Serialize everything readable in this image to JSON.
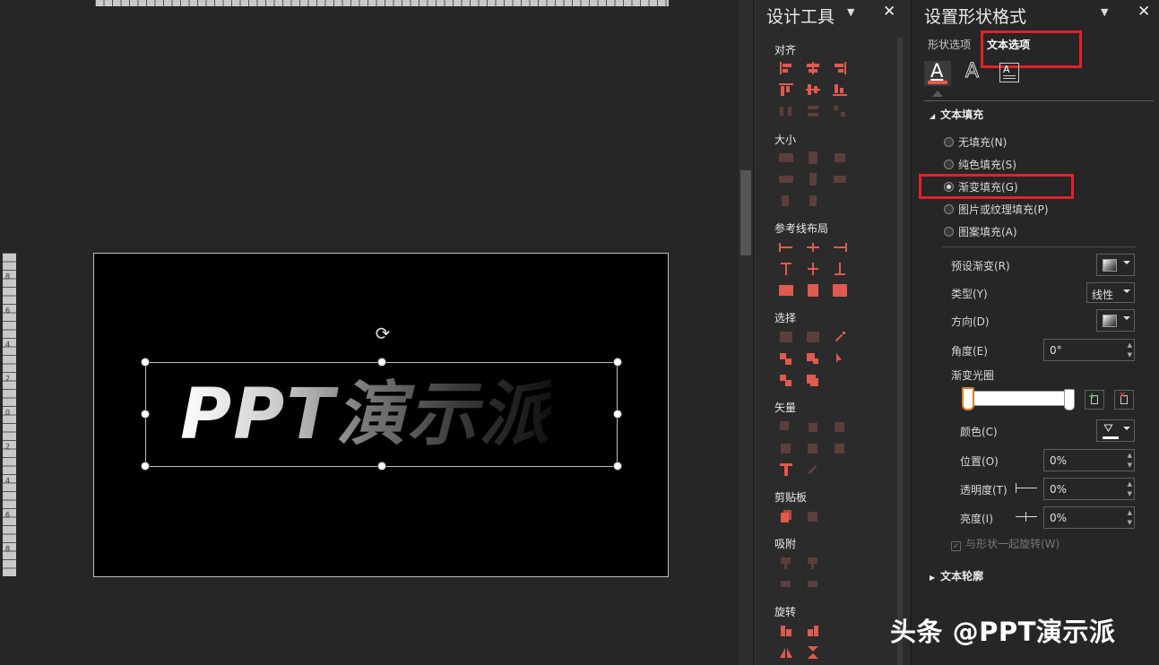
{
  "design_panel": {
    "title": "设计工具",
    "sections": {
      "align": "对齐",
      "size": "大小",
      "guides": "参考线布局",
      "select": "选择",
      "vector": "矢量",
      "clipboard": "剪贴板",
      "snap": "吸附",
      "rotate": "旋转"
    }
  },
  "format_panel": {
    "title": "设置形状格式",
    "tabs": {
      "shape_options": "形状选项",
      "text_options": "文本选项"
    },
    "text_fill": {
      "header": "文本填充",
      "options": [
        "无填充(N)",
        "纯色填充(S)",
        "渐变填充(G)",
        "图片或纹理填充(P)",
        "图案填充(A)"
      ],
      "selected_index": 2
    },
    "gradient": {
      "preset_label": "预设渐变(R)",
      "type_label": "类型(Y)",
      "type_value": "线性",
      "direction_label": "方向(D)",
      "angle_label": "角度(E)",
      "angle_value": "0°",
      "stops_label": "渐变光圈",
      "color_label": "颜色(C)",
      "position_label": "位置(O)",
      "position_value": "0%",
      "transparency_label": "透明度(T)",
      "transparency_value": "0%",
      "brightness_label": "亮度(I)",
      "brightness_value": "0%",
      "rotate_with_shape": "与形状一起旋转(W)"
    },
    "text_outline": {
      "header": "文本轮廓"
    }
  },
  "slide": {
    "text": "PPT演示派"
  },
  "vruler_labels": [
    "8",
    "6",
    "4",
    "2",
    "0",
    "2",
    "4",
    "6",
    "8"
  ],
  "watermark": "头条 @PPT演示派",
  "colors": {
    "accent": "#e05a4f",
    "highlight": "#e2212b",
    "panel_bg": "#262626"
  }
}
